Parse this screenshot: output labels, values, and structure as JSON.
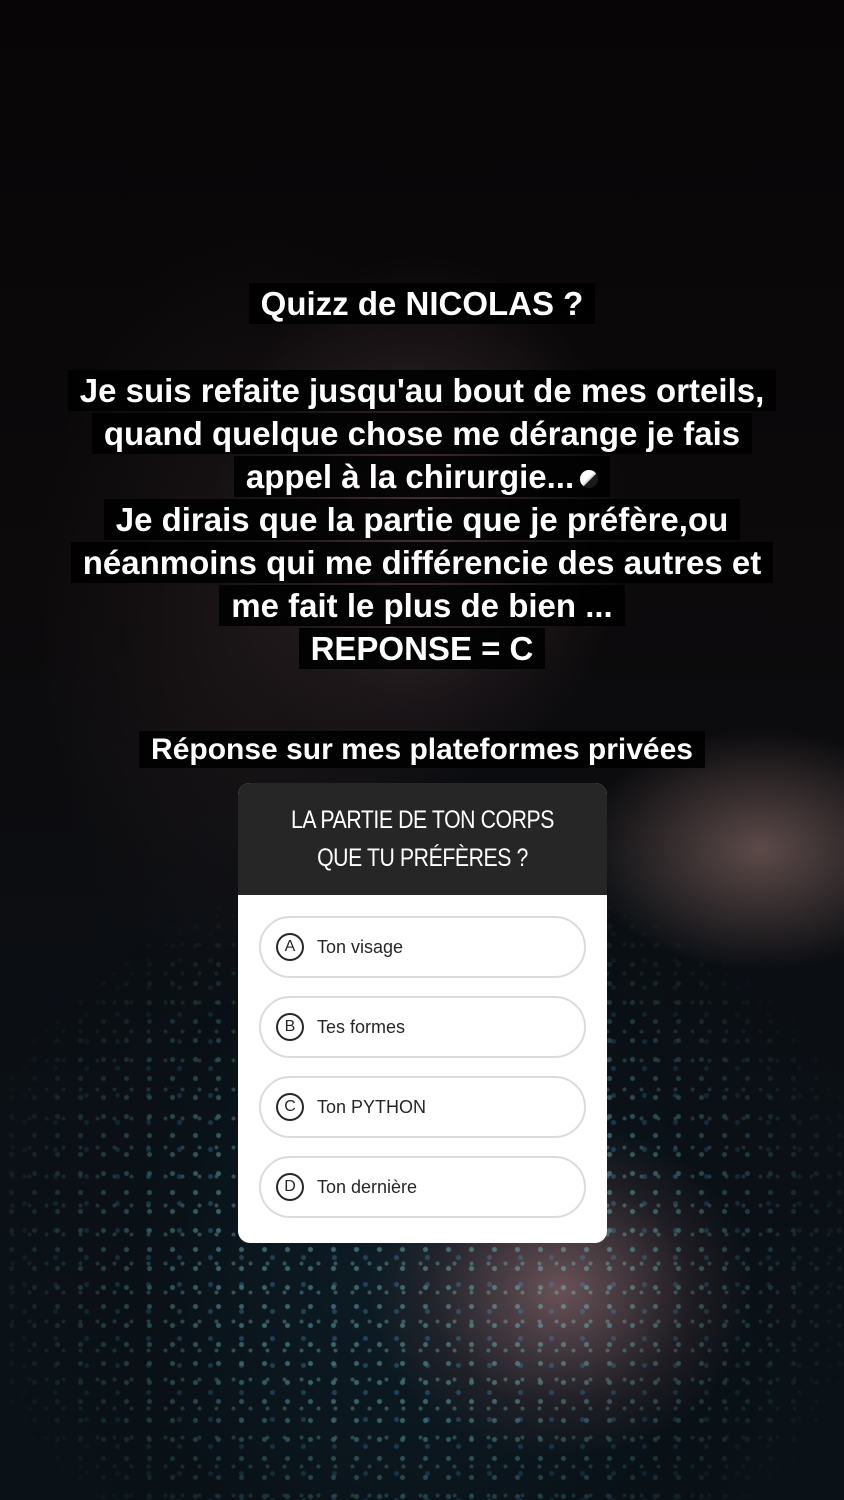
{
  "story": {
    "title": "Quizz de NICOLAS ?",
    "body_lines": [
      "Je suis refaite jusqu'au bout de mes orteils,",
      "quand quelque chose me dérange je fais",
      "appel à la chirurgie...",
      "Je dirais que la partie que je préfère,ou",
      "néanmoins qui me différencie des autres et",
      "me fait le plus de bien ...",
      "REPONSE = C"
    ],
    "reply_note": "Réponse sur mes plateformes privées"
  },
  "quiz": {
    "question": "LA PARTIE DE TON CORPS QUE TU PRÉFÈRES ?",
    "options": [
      {
        "letter": "A",
        "label": "Ton visage"
      },
      {
        "letter": "B",
        "label": "Tes formes"
      },
      {
        "letter": "C",
        "label": "Ton PYTHON"
      },
      {
        "letter": "D",
        "label": "Ton dernière"
      }
    ]
  }
}
